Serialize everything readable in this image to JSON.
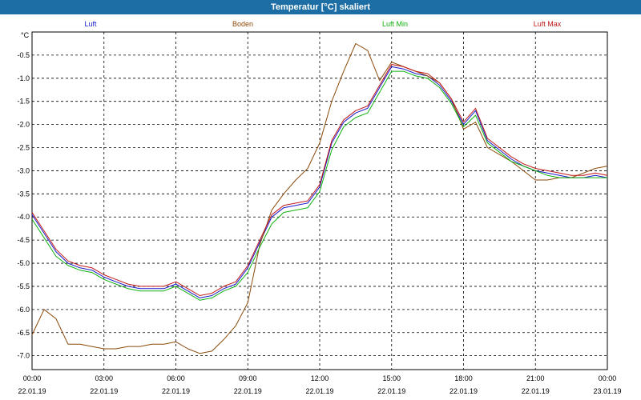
{
  "window": {
    "title": "Temperatur [°C] skaliert"
  },
  "chart_data": {
    "type": "line",
    "title": "Temperatur [°C] skaliert",
    "ylabel": "°C",
    "xlabel": "",
    "xlim": [
      "22.01.19 00:00",
      "23.01.19 00:00"
    ],
    "ylim": [
      -7.3,
      0.0
    ],
    "grid": true,
    "legend_position": "top",
    "x_ticks": [
      {
        "time": "00:00",
        "date": "22.01.19"
      },
      {
        "time": "03:00",
        "date": "22.01.19"
      },
      {
        "time": "06:00",
        "date": "22.01.19"
      },
      {
        "time": "09:00",
        "date": "22.01.19"
      },
      {
        "time": "12:00",
        "date": "22.01.19"
      },
      {
        "time": "15:00",
        "date": "22.01.19"
      },
      {
        "time": "18:00",
        "date": "22.01.19"
      },
      {
        "time": "21:00",
        "date": "22.01.19"
      },
      {
        "time": "00:00",
        "date": "23.01.19"
      }
    ],
    "y_ticks": [
      "-0.5",
      "-1.0",
      "-1.5",
      "-2.0",
      "-2.5",
      "-3.0",
      "-3.5",
      "-4.0",
      "-4.5",
      "-5.0",
      "-5.5",
      "-6.0",
      "-6.5",
      "-7.0"
    ],
    "x": [
      "00:00",
      "00:30",
      "01:00",
      "01:30",
      "02:00",
      "02:30",
      "03:00",
      "03:30",
      "04:00",
      "04:30",
      "05:00",
      "05:30",
      "06:00",
      "06:30",
      "07:00",
      "07:30",
      "08:00",
      "08:30",
      "09:00",
      "09:30",
      "10:00",
      "10:30",
      "11:00",
      "11:30",
      "12:00",
      "12:30",
      "13:00",
      "13:30",
      "14:00",
      "14:30",
      "15:00",
      "15:30",
      "16:00",
      "16:30",
      "17:00",
      "17:30",
      "18:00",
      "18:30",
      "19:00",
      "19:30",
      "20:00",
      "20:30",
      "21:00",
      "21:30",
      "22:00",
      "22:30",
      "23:00",
      "23:30",
      "00:00"
    ],
    "series": [
      {
        "name": "Luft",
        "color": "#1a1acc",
        "values": [
          -3.95,
          -4.35,
          -4.75,
          -5.0,
          -5.1,
          -5.15,
          -5.3,
          -5.4,
          -5.5,
          -5.55,
          -5.55,
          -5.55,
          -5.45,
          -5.6,
          -5.75,
          -5.7,
          -5.55,
          -5.45,
          -5.1,
          -4.55,
          -4.0,
          -3.8,
          -3.75,
          -3.7,
          -3.35,
          -2.4,
          -1.95,
          -1.75,
          -1.65,
          -1.2,
          -0.75,
          -0.8,
          -0.9,
          -0.95,
          -1.15,
          -1.5,
          -2.0,
          -1.7,
          -2.35,
          -2.55,
          -2.75,
          -2.9,
          -3.0,
          -3.05,
          -3.1,
          -3.15,
          -3.15,
          -3.1,
          -3.15
        ]
      },
      {
        "name": "Boden",
        "color": "#8b4a0a",
        "values": [
          -6.55,
          -6.0,
          -6.2,
          -6.75,
          -6.75,
          -6.8,
          -6.85,
          -6.85,
          -6.8,
          -6.8,
          -6.75,
          -6.75,
          -6.7,
          -6.85,
          -6.95,
          -6.9,
          -6.65,
          -6.35,
          -5.85,
          -4.6,
          -3.85,
          -3.5,
          -3.2,
          -2.95,
          -2.4,
          -1.5,
          -0.85,
          -0.25,
          -0.4,
          -1.05,
          -0.65,
          -0.75,
          -0.85,
          -0.95,
          -1.1,
          -1.45,
          -2.1,
          -1.95,
          -2.5,
          -2.65,
          -2.8,
          -3.0,
          -3.2,
          -3.2,
          -3.15,
          -3.15,
          -3.05,
          -2.95,
          -2.9
        ]
      },
      {
        "name": "Luft Min",
        "color": "#10b010",
        "values": [
          -4.05,
          -4.45,
          -4.85,
          -5.05,
          -5.15,
          -5.2,
          -5.35,
          -5.45,
          -5.55,
          -5.6,
          -5.6,
          -5.6,
          -5.5,
          -5.65,
          -5.8,
          -5.75,
          -5.6,
          -5.5,
          -5.2,
          -4.65,
          -4.15,
          -3.9,
          -3.85,
          -3.8,
          -3.45,
          -2.55,
          -2.05,
          -1.85,
          -1.75,
          -1.3,
          -0.85,
          -0.85,
          -0.95,
          -1.0,
          -1.2,
          -1.55,
          -2.05,
          -1.8,
          -2.4,
          -2.6,
          -2.8,
          -2.9,
          -3.0,
          -3.1,
          -3.15,
          -3.15,
          -3.15,
          -3.15,
          -3.15
        ]
      },
      {
        "name": "Luft Max",
        "color": "#c01818",
        "values": [
          -3.9,
          -4.3,
          -4.7,
          -4.95,
          -5.05,
          -5.1,
          -5.25,
          -5.35,
          -5.45,
          -5.5,
          -5.5,
          -5.5,
          -5.4,
          -5.55,
          -5.7,
          -5.65,
          -5.5,
          -5.4,
          -5.05,
          -4.5,
          -3.95,
          -3.75,
          -3.7,
          -3.65,
          -3.3,
          -2.35,
          -1.9,
          -1.7,
          -1.6,
          -1.15,
          -0.7,
          -0.75,
          -0.85,
          -0.9,
          -1.1,
          -1.45,
          -1.95,
          -1.65,
          -2.3,
          -2.5,
          -2.7,
          -2.85,
          -2.95,
          -3.0,
          -3.05,
          -3.1,
          -3.1,
          -3.05,
          -3.1
        ]
      }
    ]
  }
}
